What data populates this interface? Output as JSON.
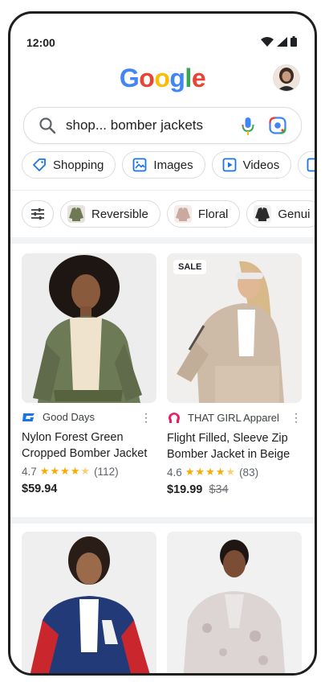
{
  "status_bar": {
    "time": "12:00"
  },
  "logo": {
    "letters": [
      "G",
      "o",
      "o",
      "g",
      "l",
      "e"
    ],
    "colors": [
      "#4285F4",
      "#EA4335",
      "#FBBC05",
      "#4285F4",
      "#34A853",
      "#EA4335"
    ]
  },
  "search": {
    "query": "shop... bomber jackets"
  },
  "tabs": [
    {
      "label": "Shopping",
      "icon": "tag-icon"
    },
    {
      "label": "Images",
      "icon": "image-icon"
    },
    {
      "label": "Videos",
      "icon": "play-icon"
    }
  ],
  "filters": [
    {
      "label": "Reversible",
      "thumb_color": "#6f7a55"
    },
    {
      "label": "Floral",
      "thumb_color": "#c9a9a0"
    },
    {
      "label": "Genui",
      "thumb_color": "#2b2b2b"
    }
  ],
  "products": [
    {
      "merchant": "Good Days",
      "merchant_color": "#1a73e8",
      "title": "Nylon Forest Green Cropped Bomber Jacket",
      "rating": "4.7",
      "stars": 4.5,
      "reviews": "(112)",
      "price": "$59.94",
      "was": "",
      "badge": ""
    },
    {
      "merchant": "THAT GIRL Apparel",
      "merchant_color": "#e91e63",
      "title": "Flight Filled, Sleeve Zip Bomber Jacket in Beige",
      "rating": "4.6",
      "stars": 4.5,
      "reviews": "(83)",
      "price": "$19.99",
      "was": "$34",
      "badge": "SALE"
    }
  ]
}
